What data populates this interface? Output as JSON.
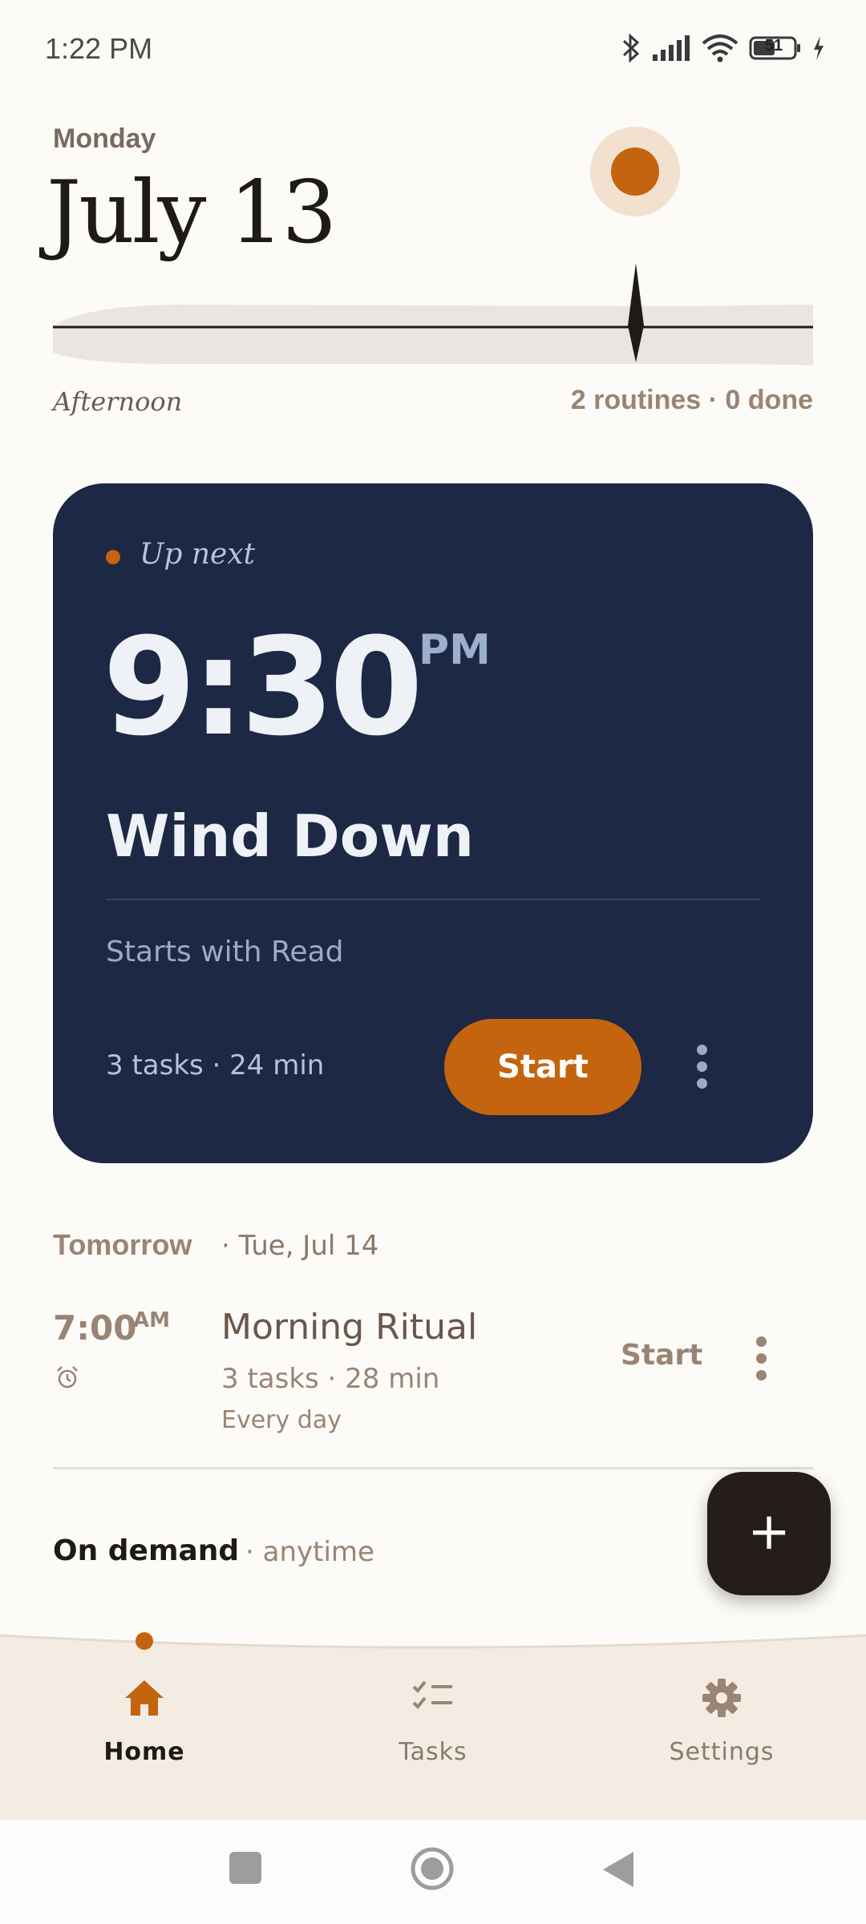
{
  "status_bar": {
    "time": "1:22 PM",
    "battery": "51",
    "icons": [
      "bluetooth-icon",
      "signal-icon",
      "wifi-icon",
      "battery-icon",
      "charging-icon"
    ]
  },
  "header": {
    "weekday": "Monday",
    "date": "July 13",
    "period": "Afternoon",
    "summary": "2 routines · 0 done"
  },
  "next_card": {
    "label": "Up next",
    "time": "9:30",
    "ampm": "PM",
    "title": "Wind Down",
    "starts_with": "Starts with Read",
    "meta": "3 tasks · 24 min",
    "start_label": "Start"
  },
  "tomorrow": {
    "label": "Tomorrow",
    "date": "· Tue, Jul 14",
    "routine": {
      "time": "7:00",
      "ampm": "AM",
      "name": "Morning Ritual",
      "meta": "3 tasks · 28 min",
      "recurrence": "Every day",
      "start_label": "Start"
    }
  },
  "on_demand": {
    "label": "On demand",
    "sub": "· anytime"
  },
  "fab": {
    "label": "+"
  },
  "nav": {
    "items": [
      {
        "label": "Home",
        "icon": "home-icon",
        "active": true
      },
      {
        "label": "Tasks",
        "icon": "tasks-icon",
        "active": false
      },
      {
        "label": "Settings",
        "icon": "gear-icon",
        "active": false
      }
    ]
  },
  "colors": {
    "accent": "#c4640f",
    "card_bg": "#1c2844",
    "background": "#fcfbf8",
    "nav_bg": "#f4ece2"
  }
}
